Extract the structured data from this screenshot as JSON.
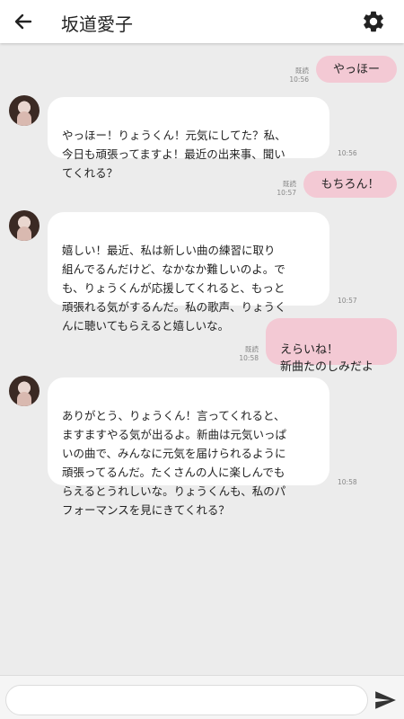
{
  "header": {
    "title": "坂道愛子"
  },
  "messages": [
    {
      "direction": "out",
      "text": "やっほー",
      "read": "既読",
      "time": "10:56"
    },
    {
      "direction": "in",
      "text": "やっほー！りょうくん！元気にしてた？私、\n今日も頑張ってますよ！最近の出来事、聞い\nてくれる？",
      "time": "10:56"
    },
    {
      "direction": "out",
      "text": "もちろん！",
      "read": "既読",
      "time": "10:57"
    },
    {
      "direction": "in",
      "text": "嬉しい！最近、私は新しい曲の練習に取り\n組んでるんだけど、なかなか難しいのよ。で\nも、りょうくんが応援してくれると、もっと\n頑張れる気がするんだ。私の歌声、りょうく\nんに聴いてもらえると嬉しいな。",
      "time": "10:57"
    },
    {
      "direction": "out",
      "text": "えらいね！\n新曲たのしみだよ",
      "read": "既読",
      "time": "10:58"
    },
    {
      "direction": "in",
      "text": "ありがとう、りょうくん！言ってくれると、\nますますやる気が出るよ。新曲は元気いっぱ\nいの曲で、みんなに元気を届けられるように\n頑張ってるんだ。たくさんの人に楽しんでも\nらえるとうれしいな。りょうくんも、私のパ\nフォーマンスを見にきてくれる？",
      "time": "10:58"
    }
  ],
  "input": {
    "placeholder": ""
  },
  "colors": {
    "outgoing_bubble": "#f3c9d4",
    "incoming_bubble": "#ffffff",
    "background": "#ececec"
  }
}
